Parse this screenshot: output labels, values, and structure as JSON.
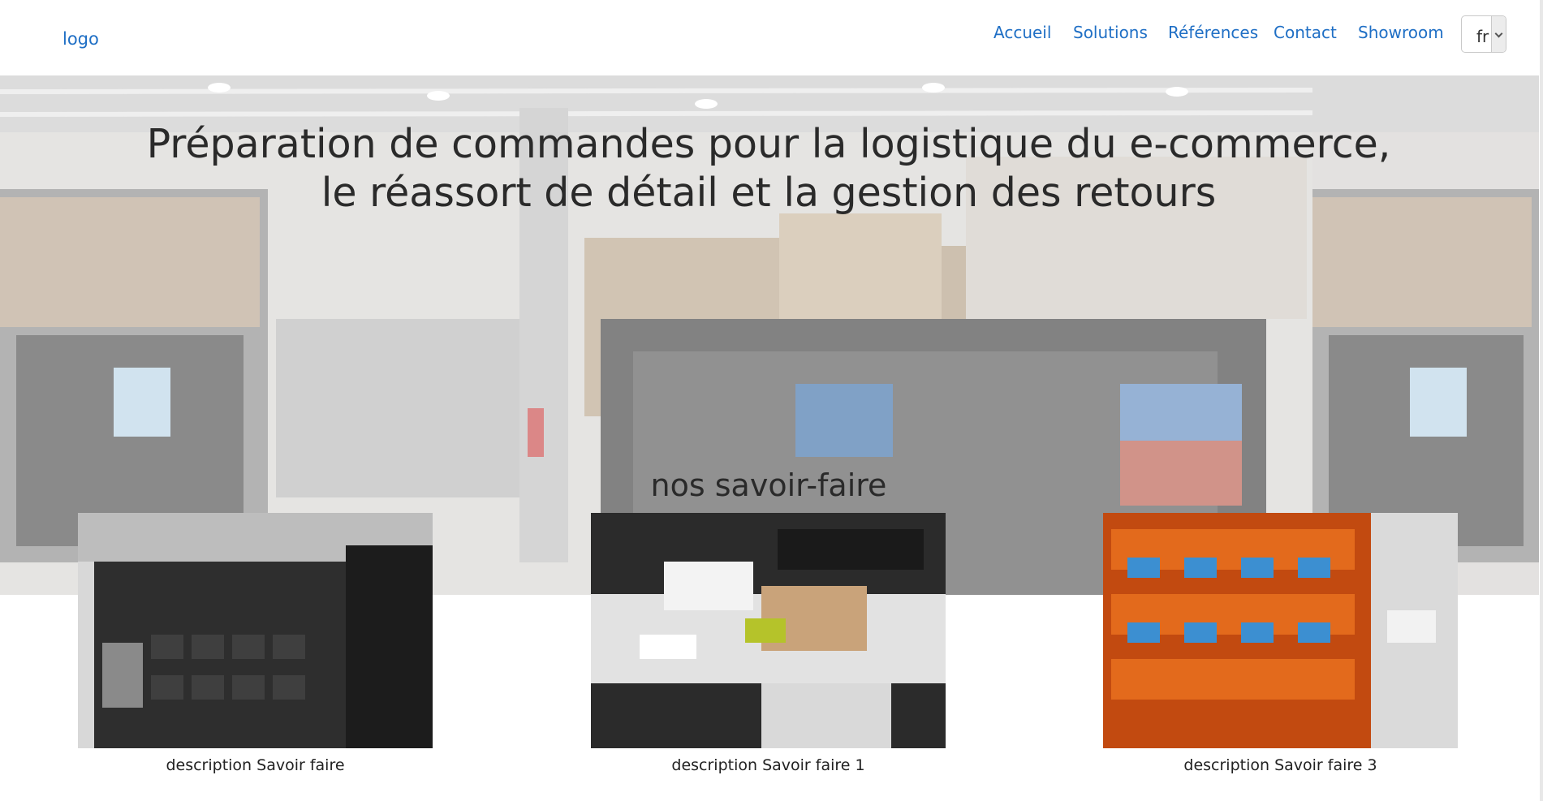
{
  "header": {
    "logo_text": "logo",
    "nav": [
      {
        "label": "Accueil"
      },
      {
        "label": "Solutions"
      },
      {
        "label": "Références"
      },
      {
        "label": "Contact"
      },
      {
        "label": "Showroom"
      }
    ],
    "language": {
      "selected": "fr"
    }
  },
  "hero": {
    "title_line1": "Préparation de commandes pour la logistique du e-commerce,",
    "title_line2": "le réassort de détail et la gestion des retours"
  },
  "savoir_faire": {
    "title": "nos savoir-faire",
    "items": [
      {
        "caption": "description Savoir faire"
      },
      {
        "caption": "description Savoir faire 1"
      },
      {
        "caption": "description Savoir faire 3"
      }
    ]
  },
  "colors": {
    "link": "#1f6fc5",
    "text": "#2a2a2a"
  }
}
